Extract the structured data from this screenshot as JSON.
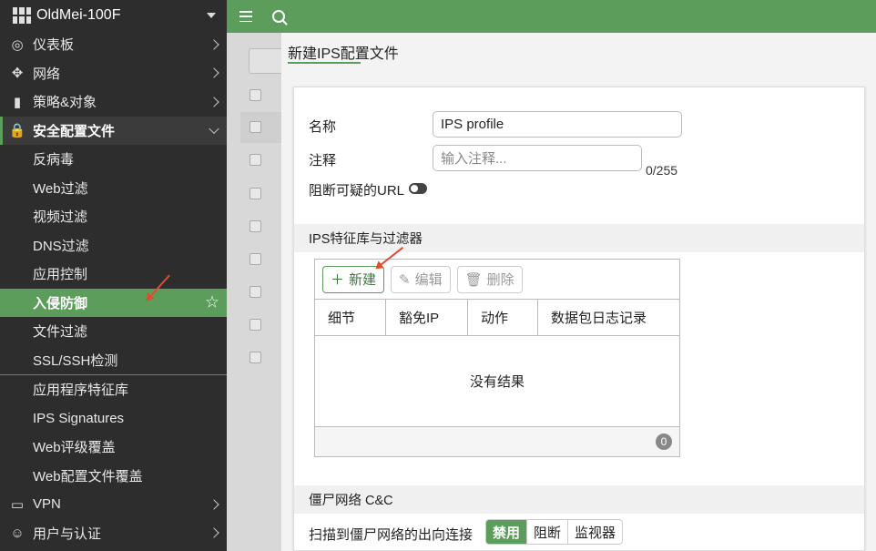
{
  "brand": {
    "title": "OldMei-100F"
  },
  "sidebar": {
    "items": [
      {
        "label": "仪表板",
        "icon": "dashboard-icon",
        "glyph": "◎",
        "type": "top",
        "chev": "right"
      },
      {
        "label": "网络",
        "icon": "network-icon",
        "glyph": "✥",
        "type": "top",
        "chev": "right"
      },
      {
        "label": "策略&对象",
        "icon": "policy-icon",
        "glyph": "▮",
        "type": "top",
        "chev": "right"
      },
      {
        "label": "安全配置文件",
        "icon": "lock-icon",
        "glyph": "🔒",
        "type": "section",
        "chev": "down"
      },
      {
        "label": "反病毒",
        "type": "sub"
      },
      {
        "label": "Web过滤",
        "type": "sub"
      },
      {
        "label": "视频过滤",
        "type": "sub"
      },
      {
        "label": "DNS过滤",
        "type": "sub"
      },
      {
        "label": "应用控制",
        "type": "sub"
      },
      {
        "label": "入侵防御",
        "type": "sub",
        "active": true
      },
      {
        "label": "文件过滤",
        "type": "sub"
      },
      {
        "label": "SSL/SSH检测",
        "type": "sub"
      },
      {
        "label": "应用程序特征库",
        "type": "sub"
      },
      {
        "label": "IPS Signatures",
        "type": "sub"
      },
      {
        "label": "Web评级覆盖",
        "type": "sub"
      },
      {
        "label": "Web配置文件覆盖",
        "type": "sub"
      },
      {
        "label": "VPN",
        "icon": "laptop-icon",
        "glyph": "▭",
        "type": "top",
        "chev": "right"
      },
      {
        "label": "用户与认证",
        "icon": "user-icon",
        "glyph": "☺",
        "type": "top",
        "chev": "right"
      }
    ]
  },
  "panel": {
    "title": "新建IPS配置文件",
    "name_label": "名称",
    "name_value": "IPS profile",
    "comment_label": "注释",
    "comment_placeholder": "输入注释...",
    "comment_counter": "0/255",
    "block_url_label": "阻断可疑的URL",
    "ips_section": "IPS特征库与过滤器",
    "toolbar": {
      "new": "新建",
      "edit": "编辑",
      "delete": "删除"
    },
    "columns": [
      "细节",
      "豁免IP",
      "动作",
      "数据包日志记录"
    ],
    "empty_text": "没有结果",
    "count": "0",
    "botnet_section": "僵尸网络 C&C",
    "botnet_label": "扫描到僵尸网络的出向连接",
    "botnet_options": [
      "禁用",
      "阻断",
      "监视器"
    ],
    "botnet_selected": "禁用"
  },
  "colors": {
    "accent": "#5c9d5c",
    "sidebar_bg": "#2d2d2d",
    "arrow": "#e24b2e"
  }
}
